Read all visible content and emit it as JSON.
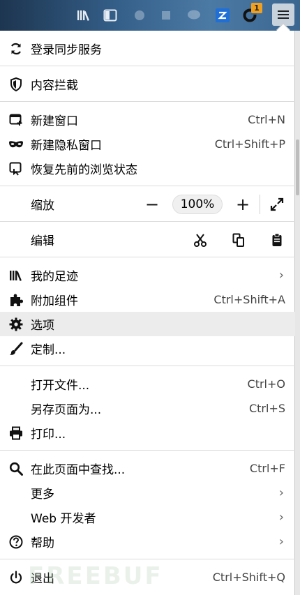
{
  "toolbar": {
    "icons": [
      "library-icon",
      "sidebar-icon",
      "extension-icon",
      "extension-icon",
      "chat-icon",
      "zotero-icon",
      "reload-icon",
      "menu-icon"
    ],
    "badge": "1"
  },
  "menu": {
    "sync": "登录同步服务",
    "tracking": "内容拦截",
    "new_window": {
      "label": "新建窗口",
      "shortcut": "Ctrl+N"
    },
    "private_window": {
      "label": "新建隐私窗口",
      "shortcut": "Ctrl+Shift+P"
    },
    "restore": "恢复先前的浏览状态",
    "zoom": {
      "label": "缩放",
      "minus": "−",
      "value": "100%",
      "plus": "+"
    },
    "edit": {
      "label": "编辑"
    },
    "library": "我的足迹",
    "addons": {
      "label": "附加组件",
      "shortcut": "Ctrl+Shift+A"
    },
    "options": "选项",
    "customize": "定制...",
    "open_file": {
      "label": "打开文件...",
      "shortcut": "Ctrl+O"
    },
    "save_as": {
      "label": "另存页面为...",
      "shortcut": "Ctrl+S"
    },
    "print": "打印...",
    "find": {
      "label": "在此页面中查找...",
      "shortcut": "Ctrl+F"
    },
    "more": "更多",
    "webdev": "Web 开发者",
    "help": "帮助",
    "quit": {
      "label": "退出",
      "shortcut": "Ctrl+Shift+Q"
    },
    "chevron": "›"
  },
  "watermark": "FREEBUF"
}
